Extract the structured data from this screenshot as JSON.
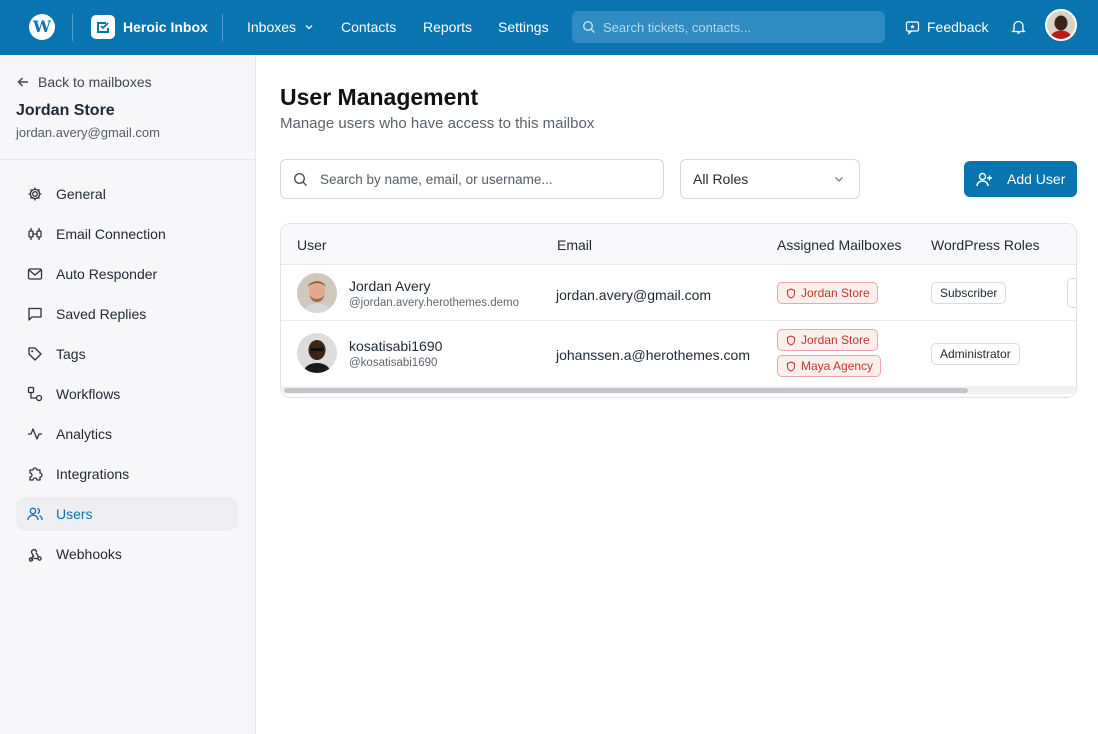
{
  "topbar": {
    "wp_glyph": "W",
    "brand": "Heroic Inbox",
    "nav": [
      "Inboxes",
      "Contacts",
      "Reports",
      "Settings"
    ],
    "search_placeholder": "Search tickets, contacts...",
    "feedback": "Feedback",
    "icons": [
      "wordpress-logo",
      "inbox-logo",
      "chevron-down-icon",
      "search-icon",
      "feedback-icon",
      "bell-icon",
      "avatar"
    ],
    "bg_color": "#0a74b1"
  },
  "sidebar": {
    "back": "Back to mailboxes",
    "store_name": "Jordan Store",
    "store_email": "jordan.avery@gmail.com",
    "items": [
      {
        "label": "General",
        "icon": "gear-icon"
      },
      {
        "label": "Email Connection",
        "icon": "plug-icon"
      },
      {
        "label": "Auto Responder",
        "icon": "mail-icon"
      },
      {
        "label": "Saved Replies",
        "icon": "message-icon"
      },
      {
        "label": "Tags",
        "icon": "tag-icon"
      },
      {
        "label": "Workflows",
        "icon": "workflow-icon"
      },
      {
        "label": "Analytics",
        "icon": "activity-icon"
      },
      {
        "label": "Integrations",
        "icon": "puzzle-icon"
      },
      {
        "label": "Users",
        "icon": "users-icon",
        "active": true
      },
      {
        "label": "Webhooks",
        "icon": "webhook-icon"
      }
    ]
  },
  "main": {
    "title": "User Management",
    "subtitle": "Manage users who have access to this mailbox",
    "search_placeholder": "Search by name, email, or username...",
    "role_filter": "All Roles",
    "add_user": "Add User",
    "table": {
      "headers": [
        "User",
        "Email",
        "Assigned Mailboxes",
        "WordPress Roles"
      ],
      "rows": [
        {
          "name": "Jordan Avery",
          "handle": "@jordan.avery.herothemes.demo",
          "email": "jordan.avery@gmail.com",
          "mailboxes": [
            "Jordan Store"
          ],
          "roles": [
            "Subscriber"
          ]
        },
        {
          "name": "kosatisabi1690",
          "handle": "@kosatisabi1690",
          "email": "johanssen.a@herothemes.com",
          "mailboxes": [
            "Jordan Store",
            "Maya Agency"
          ],
          "roles": [
            "Administrator"
          ]
        }
      ]
    }
  },
  "colors": {
    "accent": "#0a74b1",
    "mailbox_badge_bg": "#fdeeee",
    "mailbox_badge_text": "#c0392b"
  }
}
